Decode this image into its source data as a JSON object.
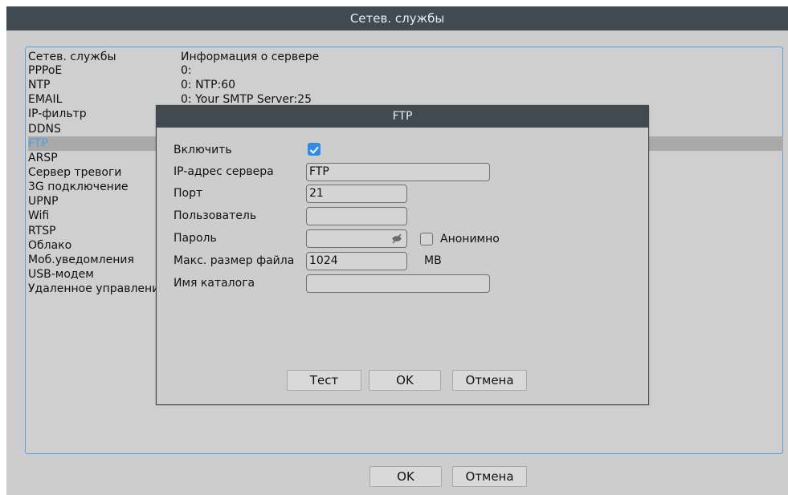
{
  "window": {
    "title": "Сетев. службы",
    "columns": {
      "service": "Сетев. службы",
      "info": "Информация о сервере"
    },
    "services": [
      {
        "name": "PPPoE",
        "info": "0:"
      },
      {
        "name": "NTP",
        "info": "0: NTP:60"
      },
      {
        "name": "EMAIL",
        "info": "0: Your SMTP Server:25"
      },
      {
        "name": "IP-фильтр",
        "info": ""
      },
      {
        "name": "DDNS",
        "info": ""
      },
      {
        "name": "FTP",
        "info": "",
        "selected": true
      },
      {
        "name": "ARSP",
        "info": ""
      },
      {
        "name": "Сервер тревоги",
        "info": ""
      },
      {
        "name": "3G подключение",
        "info": ""
      },
      {
        "name": "UPNP",
        "info": ""
      },
      {
        "name": "Wifi",
        "info": ""
      },
      {
        "name": "RTSP",
        "info": ""
      },
      {
        "name": "Облако",
        "info": ""
      },
      {
        "name": "Моб.уведомления",
        "info": ""
      },
      {
        "name": "USB-модем",
        "info": ""
      },
      {
        "name": "Удаленное управление",
        "info": ""
      }
    ],
    "ok_label": "OK",
    "cancel_label": "Отмена"
  },
  "ftp_dialog": {
    "title": "FTP",
    "enable_label": "Включить",
    "enable_checked": true,
    "server_label": "IP-адрес сервера",
    "server_value": "FTP",
    "port_label": "Порт",
    "port_value": "21",
    "user_label": "Пользователь",
    "user_value": "",
    "password_label": "Пароль",
    "password_value": "",
    "anonymous_label": "Анонимно",
    "anonymous_checked": false,
    "max_file_label": "Макс. размер файла",
    "max_file_value": "1024",
    "max_file_unit": "MB",
    "dir_label": "Имя каталога",
    "dir_value": "",
    "test_label": "Тест",
    "ok_label": "OK",
    "cancel_label": "Отмена"
  },
  "colors": {
    "title_bar": "#414a51",
    "panel_border": "#5a9fdc",
    "selected_text": "#4a9ee8",
    "checkbox_checked": "#2f8be6"
  }
}
